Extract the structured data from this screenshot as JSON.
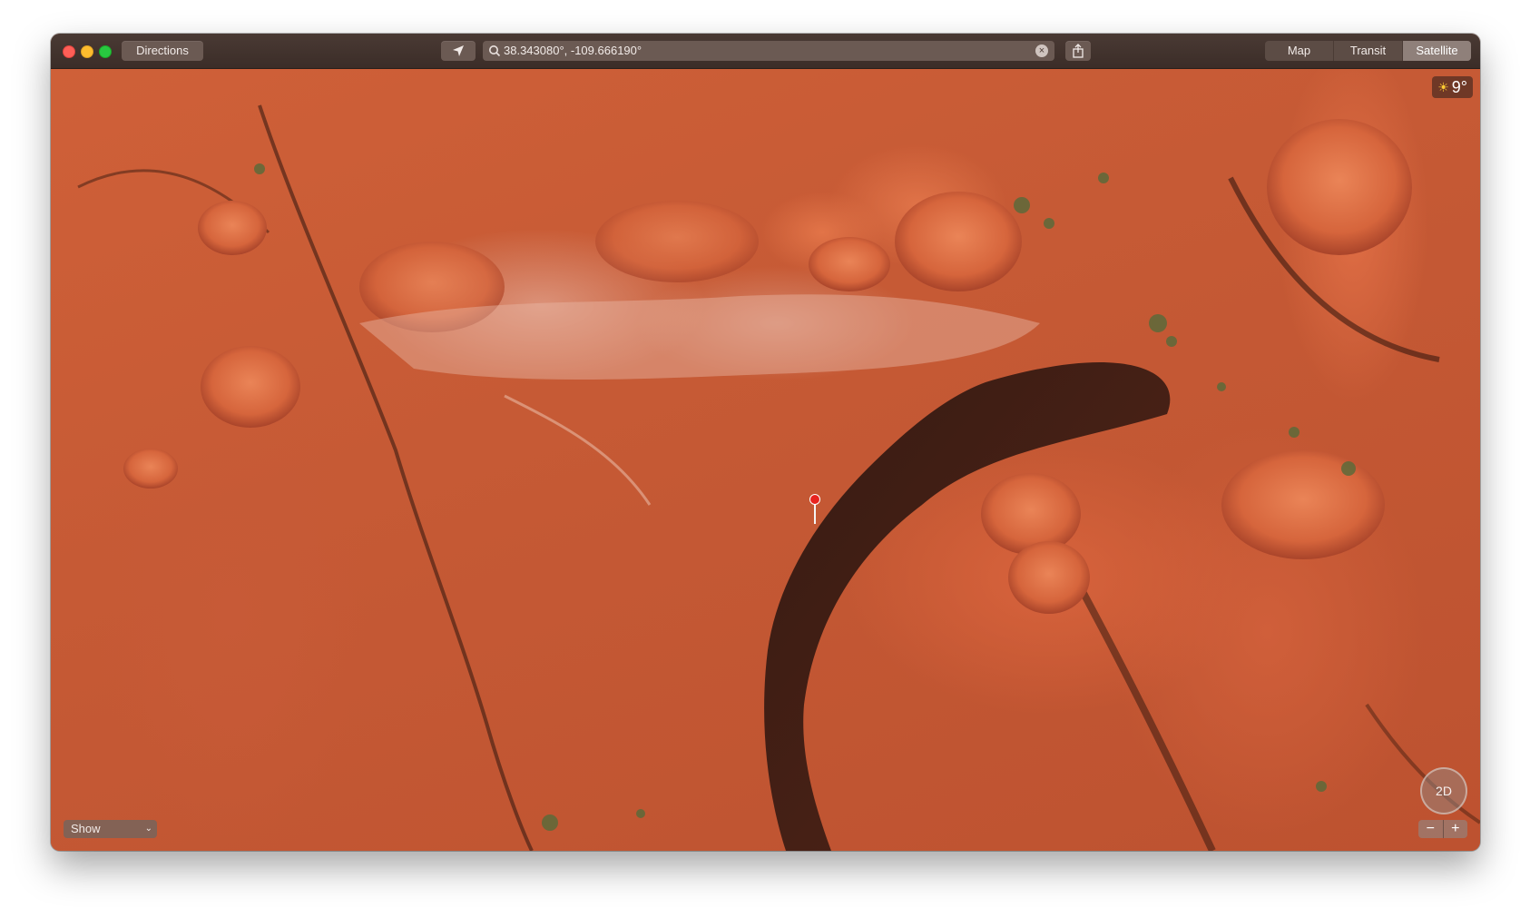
{
  "toolbar": {
    "directions_label": "Directions",
    "search_value": "38.343080°, -109.666190°",
    "map_modes": [
      "Map",
      "Transit",
      "Satellite"
    ],
    "active_mode": "Satellite",
    "icons": [
      "close-window-icon",
      "minimize-window-icon",
      "zoom-window-icon",
      "location-arrow-icon",
      "search-icon",
      "clear-icon",
      "share-icon"
    ]
  },
  "map": {
    "weather_temp": "9°",
    "weather_icon": "sun-icon",
    "show_label": "Show",
    "compass_label": "2D",
    "zoom_out": "−",
    "zoom_in": "+",
    "pin_color": "#e8231f"
  },
  "colors": {
    "titlebar": "#3f302b",
    "terrain": "#c65a35"
  }
}
